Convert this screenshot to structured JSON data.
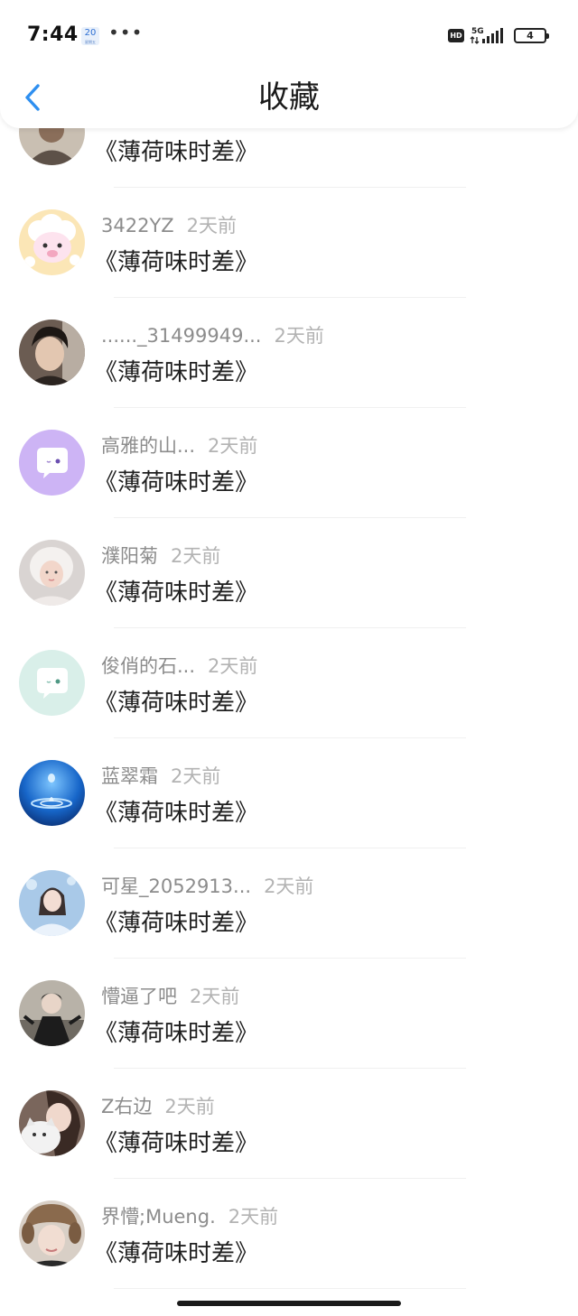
{
  "status_bar": {
    "time": "7:44",
    "date_badge": "20",
    "date_badge_sub": "星期五",
    "more_dots": "•••",
    "hd": "HD",
    "network": "5G",
    "battery": "4"
  },
  "header": {
    "title": "收藏",
    "back_icon": "chevron-left-icon"
  },
  "favorites": [
    {
      "name": "",
      "time": "",
      "title": "《薄荷味时差》",
      "avatar": "photo-person"
    },
    {
      "name": "3422YZ",
      "time": "2天前",
      "title": "《薄荷味时差》",
      "avatar": "cartoon-sheep"
    },
    {
      "name": "......_31499949...",
      "time": "2天前",
      "title": "《薄荷味时差》",
      "avatar": "photo-person"
    },
    {
      "name": "高雅的山...",
      "time": "2天前",
      "title": "《薄荷味时差》",
      "avatar": "default-purple"
    },
    {
      "name": "濮阳菊",
      "time": "2天前",
      "title": "《薄荷味时差》",
      "avatar": "photo-person"
    },
    {
      "name": "俊俏的石...",
      "time": "2天前",
      "title": "《薄荷味时差》",
      "avatar": "default-mint"
    },
    {
      "name": "蓝翠霜",
      "time": "2天前",
      "title": "《薄荷味时差》",
      "avatar": "water-drop"
    },
    {
      "name": "可星_2052913...",
      "time": "2天前",
      "title": "《薄荷味时差》",
      "avatar": "photo-person"
    },
    {
      "name": "懵逼了吧",
      "time": "2天前",
      "title": "《薄荷味时差》",
      "avatar": "photo-person"
    },
    {
      "name": "Z右边",
      "time": "2天前",
      "title": "《薄荷味时差》",
      "avatar": "photo-person"
    },
    {
      "name": "界懵;Mueng.",
      "time": "2天前",
      "title": "《薄荷味时差》",
      "avatar": "photo-person"
    }
  ],
  "colors": {
    "accent": "#2e8ff0",
    "meta_text": "#8c8c8c",
    "time_text": "#b3b3b3",
    "avatar_purple": "#cdb4f5",
    "avatar_mint": "#d9efe9"
  }
}
